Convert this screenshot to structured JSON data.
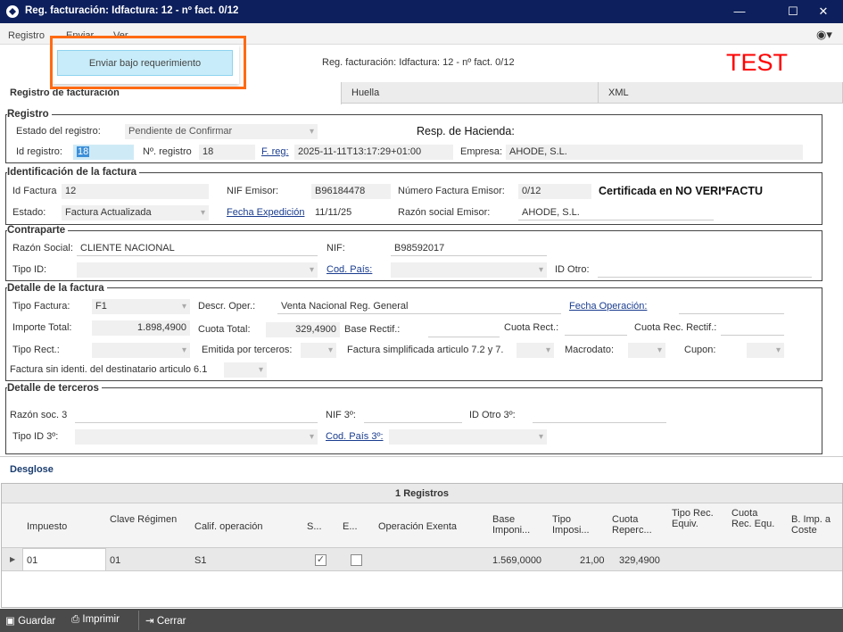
{
  "window": {
    "title": "Reg. facturación: Idfactura: 12 - nº fact. 0/12",
    "min": "—",
    "max": "☐",
    "close": "✕"
  },
  "menu": {
    "items": [
      "Registro",
      "Enviar",
      "Ver"
    ],
    "dropdown_item": "Enviar bajo requerimiento"
  },
  "header": {
    "subtitle": "Reg. facturación: Idfactura: 12 - nº fact. 0/12",
    "env": "TEST"
  },
  "tabs": [
    "Registro de facturación",
    "Huella",
    "XML"
  ],
  "registro": {
    "title": "Registro",
    "estado_label": "Estado del registro:",
    "estado": "Pendiente de  Confirmar",
    "resp_label": "Resp. de Hacienda:",
    "id_label": "Id registro:",
    "id": "18",
    "nreg_label": "Nº. registro",
    "nreg": "18",
    "freg_label": "F. reg:",
    "freg": "2025-11-11T13:17:29+01:00",
    "empresa_label": "Empresa:",
    "empresa": "AHODE, S.L."
  },
  "ident": {
    "title": "Identificación de la factura",
    "idf_label": "Id Factura",
    "idf": "12",
    "nif_label": "NIF Emisor:",
    "nif": "B96184478",
    "num_label": "Número Factura Emisor:",
    "num": "0/12",
    "cert": "Certificada en NO VERI*FACTU",
    "estado_label": "Estado:",
    "estado": "Factura Actualizada",
    "fexp_label": "Fecha Expedición",
    "fexp": "11/11/25",
    "razon_label": "Razón social Emisor:",
    "razon": "AHODE, S.L."
  },
  "contra": {
    "title": "Contraparte",
    "razon_label": "Razón Social:",
    "razon": "CLIENTE NACIONAL",
    "nif_label": "NIF:",
    "nif": "B98592017",
    "tipoid_label": "Tipo ID:",
    "pais_label": "Cod. País:",
    "idotro_label": "ID Otro:"
  },
  "detalle": {
    "title": "Detalle de la factura",
    "tipo_label": "Tipo Factura:",
    "tipo": "F1",
    "descr_label": "Descr. Oper.:",
    "descr": "Venta Nacional Reg. General",
    "fop_label": "Fecha Operación:",
    "imp_label": "Importe Total:",
    "imp": "1.898,4900",
    "cuota_label": "Cuota Total:",
    "cuota": "329,4900",
    "base_label": "Base Rectif.:",
    "cuotar_label": "Cuota Rect.:",
    "cuotarec_label": "Cuota Rec. Rectif.:",
    "tiporect_label": "Tipo Rect.:",
    "emitida_label": "Emitida por terceros:",
    "simpl_label": "Factura simplificada articulo 7.2 y 7.",
    "macro_label": "Macrodato:",
    "cupon_label": "Cupon:",
    "sinid_label": "Factura sin identi. del destinatario articulo 6.1"
  },
  "terceros": {
    "title": "Detalle de terceros",
    "razon_label": "Razón soc. 3",
    "nif_label": "NIF 3º:",
    "idotro_label": "ID Otro 3º:",
    "tipoid_label": "Tipo ID 3º:",
    "pais_label": "Cod. País 3º:"
  },
  "desglose": {
    "title": "Desglose",
    "count": "1 Registros",
    "columns": [
      "Impuesto",
      "Clave Régimen",
      "Calif. operación",
      "S...",
      "E...",
      "Operación Exenta",
      "Base Imponi...",
      "Tipo Imposi...",
      "Cuota Reperc...",
      "Tipo Rec. Equiv.",
      "Cuota Rec. Equ.",
      "B. Imp. a Coste"
    ],
    "row": {
      "impuesto": "01",
      "clave": "01",
      "calif": "S1",
      "s": true,
      "e": false,
      "base": "1.569,0000",
      "tipo": "21,00",
      "cuota": "329,4900"
    }
  },
  "toolbar": {
    "guardar": "Guardar",
    "imprimir": "Imprimir",
    "cerrar": "Cerrar"
  },
  "colors": {
    "titlebar": "#0d1f5c",
    "test": "#ff0000",
    "highlight": "#ff6a13",
    "toolbar": "#4a4a4a"
  }
}
